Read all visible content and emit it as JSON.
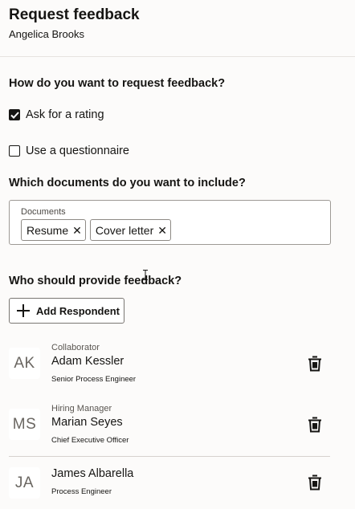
{
  "header": {
    "title": "Request feedback",
    "subtitle": "Angelica Brooks"
  },
  "request_section": {
    "heading": "How do you want to request feedback?",
    "options": [
      {
        "label": "Ask for a rating",
        "checked": true
      },
      {
        "label": "Use a questionnaire",
        "checked": false
      }
    ]
  },
  "documents_section": {
    "heading": "Which documents do you want to include?",
    "field_label": "Documents",
    "chips": [
      {
        "label": "Resume"
      },
      {
        "label": "Cover letter"
      }
    ],
    "remove_glyph": "✕"
  },
  "respondents_section": {
    "heading": "Who should provide feedback?",
    "add_button_label": "Add Respondent",
    "respondents": [
      {
        "initials": "AK",
        "role": "Collaborator",
        "name": "Adam Kessler",
        "title": "Senior Process Engineer"
      },
      {
        "initials": "MS",
        "role": "Hiring Manager",
        "name": "Marian Seyes",
        "title": "Chief Executive Officer"
      },
      {
        "initials": "JA",
        "role": "",
        "name": "James Albarella",
        "title": "Process Engineer"
      }
    ]
  }
}
